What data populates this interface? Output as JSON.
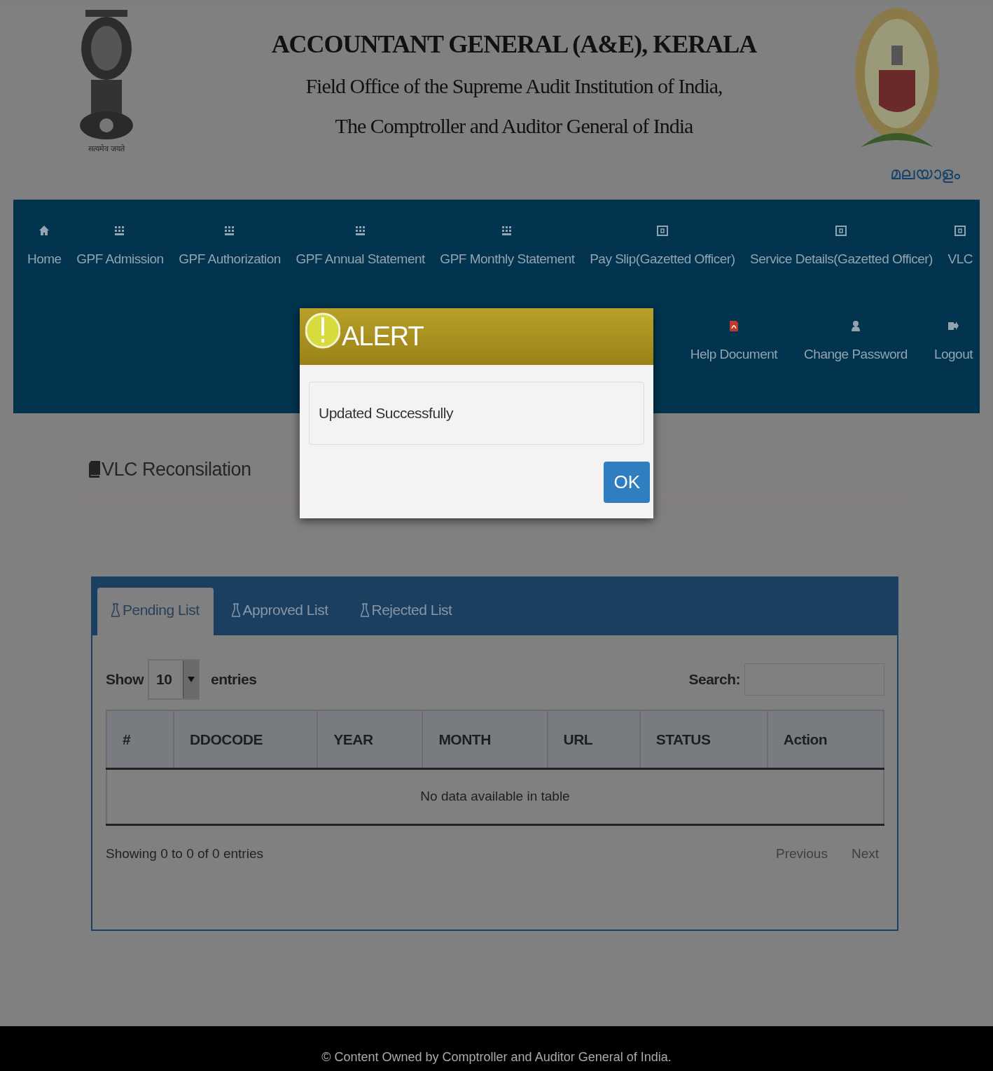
{
  "header": {
    "title": "ACCOUNTANT GENERAL (A&E), KERALA",
    "subtitle_1": "Field Office of the Supreme Audit Institution of India,",
    "subtitle_2": "The Comptroller and Auditor General of India",
    "motto": "सत्यमेव जयते",
    "language_link": "മലയാളം"
  },
  "nav": {
    "primary": [
      {
        "label": "Home",
        "kind": "home"
      },
      {
        "label": "GPF Admission",
        "kind": "grid"
      },
      {
        "label": "GPF Authorization",
        "kind": "grid"
      },
      {
        "label": "GPF Annual Statement",
        "kind": "grid"
      },
      {
        "label": "GPF Monthly Statement",
        "kind": "grid"
      },
      {
        "label": "Pay Slip(Gazetted Officer)",
        "kind": "frame"
      },
      {
        "label": "Service Details(Gazetted Officer)",
        "kind": "frame"
      },
      {
        "label": "VLC",
        "kind": "frame"
      }
    ],
    "secondary": [
      {
        "label": "Help Document",
        "kind": "pdf"
      },
      {
        "label": "Change Password",
        "kind": "user"
      },
      {
        "label": "Logout",
        "kind": "logout"
      }
    ]
  },
  "page_title": "VLC Reconsilation",
  "tabs": [
    {
      "label": "Pending List",
      "selected": true
    },
    {
      "label": "Approved List",
      "selected": false
    },
    {
      "label": "Rejected List",
      "selected": false
    }
  ],
  "table_controls": {
    "show_label": "Show",
    "page_size": "10",
    "entries_label": "entries",
    "search_label": "Search:"
  },
  "table": {
    "columns": [
      "#",
      "DDOCODE",
      "YEAR",
      "MONTH",
      "URL",
      "STATUS",
      "Action"
    ],
    "empty_message": "No data available in table"
  },
  "table_info": "Showing 0 to 0 of 0 entries",
  "pagination": [
    "Previous",
    "Next"
  ],
  "footer": "© Content Owned by Comptroller and Auditor General of India.",
  "alert": {
    "title": "ALERT",
    "message": "Updated Successfully",
    "button": "OK"
  }
}
